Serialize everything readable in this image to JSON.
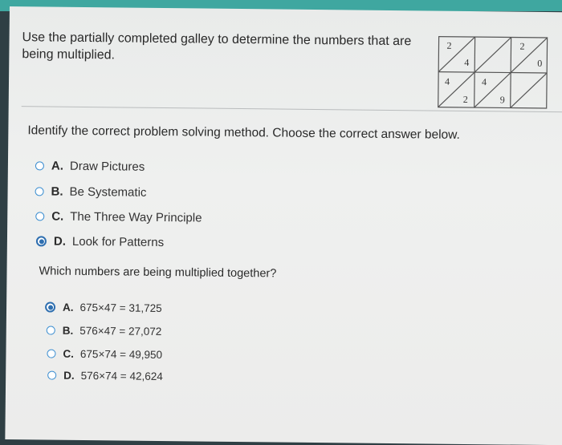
{
  "question": "Use the partially completed galley to determine the numbers that are being multiplied.",
  "galley_digits": {
    "cell_0_0": [
      "2",
      "4"
    ],
    "cell_0_1": [
      "",
      ""
    ],
    "cell_0_2": [
      "2",
      "0"
    ],
    "cell_1_0": [
      "4",
      "2"
    ],
    "cell_1_1": [
      "4",
      "9"
    ],
    "cell_1_2": [
      "",
      ""
    ]
  },
  "method_prompt": "Identify the correct problem solving method. Choose the correct answer below.",
  "method_options": [
    {
      "letter": "A.",
      "text": "Draw Pictures",
      "selected": false
    },
    {
      "letter": "B.",
      "text": "Be Systematic",
      "selected": false
    },
    {
      "letter": "C.",
      "text": "The Three Way Principle",
      "selected": false
    },
    {
      "letter": "D.",
      "text": "Look for Patterns",
      "selected": true
    }
  ],
  "numbers_prompt": "Which numbers are being multiplied together?",
  "number_options": [
    {
      "letter": "A.",
      "text": "675×47 = 31,725",
      "selected": true
    },
    {
      "letter": "B.",
      "text": "576×47 = 27,072",
      "selected": false
    },
    {
      "letter": "C.",
      "text": "675×74 = 49,950",
      "selected": false
    },
    {
      "letter": "D.",
      "text": "576×74 = 42,624",
      "selected": false
    }
  ],
  "colors": {
    "radio_border": "#3d8fd1",
    "radio_selected": "#2f6fb0",
    "separator": "#b9bcbd"
  }
}
